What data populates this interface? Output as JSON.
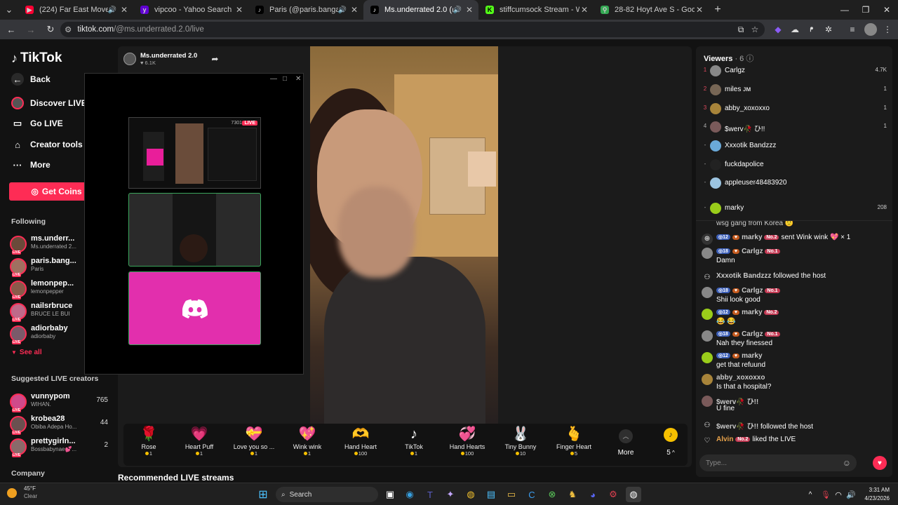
{
  "browser": {
    "tabs": [
      {
        "title": "(224) Far East Movement - Like",
        "favicon": "youtube-icon",
        "color": "#ff0033"
      },
      {
        "title": "vipcoo - Yahoo Search Results",
        "favicon": "yahoo-icon",
        "color": "#6001d2"
      },
      {
        "title": "Paris (@paris.bangaa2) is LIVE",
        "favicon": "tiktok-icon",
        "color": "#000000"
      },
      {
        "title": "Ms.underrated 2.0 (@ms.und",
        "favicon": "tiktok-icon",
        "color": "#000000"
      },
      {
        "title": "stiffcumsock Stream - Watch Li",
        "favicon": "kick-icon",
        "color": "#53fc18"
      },
      {
        "title": "28-82 Hoyt Ave S - Google Ma",
        "favicon": "maps-icon",
        "color": "#34a853"
      }
    ],
    "url_host": "tiktok.com",
    "url_path": "/@ms.underrated.2.0/live"
  },
  "sidebar": {
    "logo": "TikTok",
    "back": "Back",
    "nav": [
      {
        "label": "Discover LIVE",
        "icon": "live-avatar-icon"
      },
      {
        "label": "Go LIVE",
        "icon": "camera-icon"
      },
      {
        "label": "Creator tools",
        "icon": "home-icon"
      },
      {
        "label": "More",
        "icon": "ellipsis-icon"
      }
    ],
    "get_coins": "Get Coins",
    "following_title": "Following",
    "following": [
      {
        "name": "ms.underr...",
        "sub": "Ms.underrated 2..."
      },
      {
        "name": "paris.bang...",
        "sub": "Paris"
      },
      {
        "name": "lemonpep...",
        "sub": "lemonpepper"
      },
      {
        "name": "nailsrbruce",
        "sub": "BRUCE LE BUI"
      },
      {
        "name": "adiorbaby",
        "sub": "adiorbaby"
      }
    ],
    "see_all": "See all",
    "suggested_title": "Suggested LIVE creators",
    "suggested": [
      {
        "name": "vunnypom",
        "sub": "WIHAN.",
        "count": "765"
      },
      {
        "name": "krobea28",
        "sub": "Obiba Adepa Ho...",
        "count": "44"
      },
      {
        "name": "prettygirln...",
        "sub": "Bossbabynae💕...",
        "count": "2"
      }
    ],
    "company": "Company"
  },
  "host": {
    "name": "Ms.underrated 2.0",
    "likes": "6.1K"
  },
  "popup": {
    "live_badge": "LIVE",
    "viewers": "7301"
  },
  "gifts": [
    {
      "name": "Rose",
      "price": "1",
      "icon": "🌹"
    },
    {
      "name": "Heart Puff",
      "price": "1",
      "icon": "💗"
    },
    {
      "name": "Love you so ...",
      "price": "1",
      "icon": "💝"
    },
    {
      "name": "Wink wink",
      "price": "1",
      "icon": "💖"
    },
    {
      "name": "Hand Heart",
      "price": "100",
      "icon": "🫶"
    },
    {
      "name": "TikTok",
      "price": "1",
      "icon": "♪"
    },
    {
      "name": "Hand Hearts",
      "price": "100",
      "icon": "💞"
    },
    {
      "name": "Tiny Bunny",
      "price": "10",
      "icon": "🐰"
    },
    {
      "name": "Finger Heart",
      "price": "5",
      "icon": "🫰"
    }
  ],
  "more_label": "More",
  "coin_count": "5",
  "recommended": "Recommended LIVE streams",
  "viewers": {
    "title": "Viewers",
    "count": "6",
    "list": [
      {
        "rank": "1",
        "name": "Carlgz",
        "score": "4.7K"
      },
      {
        "rank": "2",
        "name": "miles ᴊᴍ",
        "score": "1"
      },
      {
        "rank": "3",
        "name": "abby_xoxoxxo",
        "score": "1"
      },
      {
        "rank": "4",
        "name": "$werv🥀 ひ!!",
        "score": "1"
      },
      {
        "rank": "-",
        "name": "Xxxotik Bandzzz",
        "score": ""
      },
      {
        "rank": "-",
        "name": "fuckdapolice",
        "score": ""
      },
      {
        "rank": "-",
        "name": "appleuser48483920",
        "score": ""
      },
      {
        "rank": "-",
        "name": "marky",
        "score": "208"
      }
    ]
  },
  "chat": {
    "top_fragment": "wsg gang from Korea 🙂",
    "messages": [
      {
        "user": "marky",
        "level": "12",
        "rank": "No.2",
        "text": "sent Wink wink 💖 × 1",
        "inline": true
      },
      {
        "user": "Carlgz",
        "level": "18",
        "rank": "No.1",
        "text": "Damn",
        "inline": false
      },
      {
        "user": "Xxxotik Bandzzz",
        "level": "",
        "rank": "",
        "text": "followed the host",
        "inline": true
      },
      {
        "user": "Carlgz",
        "level": "18",
        "rank": "No.1",
        "text": "Shii look good",
        "inline": false
      },
      {
        "user": "marky",
        "level": "12",
        "rank": "No.2",
        "text": "😂 😂",
        "inline": false
      },
      {
        "user": "Carlgz",
        "level": "18",
        "rank": "No.1",
        "text": "Nah they finessed",
        "inline": false
      },
      {
        "user": "marky",
        "level": "12",
        "rank": "",
        "text": "get that refuund",
        "inline": false
      },
      {
        "user": "abby_xoxoxxo",
        "level": "",
        "rank": "",
        "text": "Is that a hospital?",
        "inline": false
      },
      {
        "user": "$werv🥀 ひ!!",
        "level": "",
        "rank": "",
        "text": "U fine",
        "inline": false
      },
      {
        "user": "$werv🥀 ひ!!",
        "level": "",
        "rank": "",
        "text": "followed the host",
        "inline": true
      },
      {
        "user": "Alvin",
        "level": "",
        "rank": "No.2",
        "text": "liked the LIVE",
        "inline": true
      }
    ],
    "input_placeholder": "Type..."
  },
  "taskbar": {
    "temp": "45°F",
    "weather": "Clear",
    "search": "Search",
    "time": "3:31 AM",
    "date": "4/23/2026"
  }
}
